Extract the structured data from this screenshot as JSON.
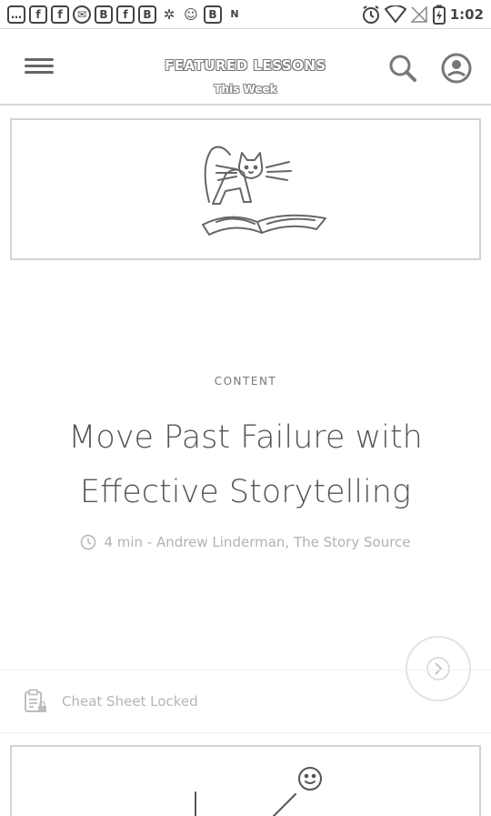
{
  "status_bar": {
    "time": "1:02",
    "notification_icons": [
      "message-icon",
      "facebook-icon",
      "facebook-icon",
      "email-icon",
      "bookmark-b-icon",
      "facebook-icon",
      "bookmark-b-icon",
      "settings-icon",
      "cat-icon",
      "bookmark-b-icon",
      "n-icon"
    ],
    "notification_glyphs": [
      "…",
      "f",
      "f",
      "✉",
      "B",
      "f",
      "B",
      "✲",
      "☺",
      "B",
      "N"
    ],
    "system_icons": [
      "alarm-icon",
      "wifi-icon",
      "no-signal-icon",
      "battery-icon"
    ]
  },
  "app_bar": {
    "title": "FEATURED LESSONS",
    "subtitle": "This Week"
  },
  "lesson": {
    "category": "CONTENT",
    "title": "Move Past Failure with Effective Storytelling",
    "meta": "4 min - Andrew Linderman, The Story Source",
    "image_icon": "cat-on-book-illustration"
  },
  "cheat_sheet": {
    "label": "Cheat Sheet Locked"
  },
  "next_lesson": {
    "image_icon": "growth-chart-illustration"
  }
}
